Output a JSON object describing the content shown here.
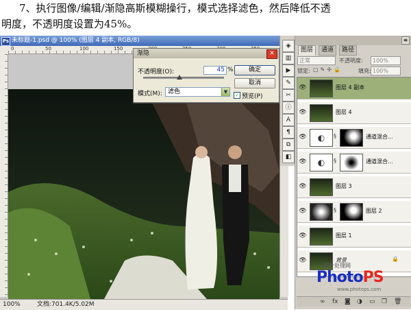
{
  "instruction": {
    "line1": "7、执行图像/编辑/渐隐高斯模糊操行，模式选择滤色，然后降低不透",
    "line2": "明度，不透明度设置为45%。"
  },
  "document": {
    "title": "未标题-1.psd @ 100% (图层 4 副本, RGB/8)",
    "ruler_numbers": [
      "0",
      "50",
      "100",
      "150",
      "200",
      "250",
      "300",
      "350"
    ],
    "status_zoom": "100%",
    "status_doc": "文档:701.4K/5.02M"
  },
  "fade_dialog": {
    "title": "渐隐",
    "opacity_label": "不透明度(O):",
    "opacity_value": "45",
    "percent": "%",
    "mode_label": "模式(M):",
    "mode_value": "滤色",
    "ok_label": "确定",
    "cancel_label": "取消",
    "preview_label": "预览(P)",
    "preview_checked": true,
    "opacity_fraction": 0.45
  },
  "tools": [
    {
      "icon": "navigator-icon",
      "glyph": "◈"
    },
    {
      "icon": "histogram-icon",
      "glyph": "▥"
    },
    {
      "icon": "play-icon",
      "glyph": "▶"
    },
    {
      "icon": "brush-icon",
      "glyph": "✎"
    },
    {
      "icon": "tools-icon",
      "glyph": "✂"
    },
    {
      "icon": "info-icon",
      "glyph": "ⓘ"
    },
    {
      "icon": "character-icon",
      "glyph": "A"
    },
    {
      "icon": "paragraph-icon",
      "glyph": "¶"
    },
    {
      "icon": "clone-icon",
      "glyph": "⧉"
    },
    {
      "icon": "layers-icon",
      "glyph": "◧"
    }
  ],
  "layers_panel": {
    "tabs": [
      "图层",
      "通道",
      "路径"
    ],
    "blend_mode": "正常",
    "opacity_label": "不透明度:",
    "opacity_value": "100%",
    "lock_label": "锁定:",
    "fill_label": "填充:",
    "fill_value": "100%",
    "layers": [
      {
        "name": "图层 4 副本",
        "selected": true,
        "mask": false,
        "thumb": "photo"
      },
      {
        "name": "图层 4",
        "selected": false,
        "mask": false,
        "thumb": "photo"
      },
      {
        "name": "通道混合...",
        "selected": false,
        "mask": true,
        "thumb": "adjust",
        "mask_style": "dark"
      },
      {
        "name": "通道混合...",
        "selected": false,
        "mask": true,
        "thumb": "adjust",
        "mask_style": "light"
      },
      {
        "name": "图层 3",
        "selected": false,
        "mask": false,
        "thumb": "photo"
      },
      {
        "name": "图层 2",
        "selected": false,
        "mask": true,
        "thumb": "gradient",
        "mask_style": "dark"
      },
      {
        "name": "图层 1",
        "selected": false,
        "mask": false,
        "thumb": "photo"
      },
      {
        "name": "背景",
        "selected": false,
        "mask": false,
        "thumb": "photo",
        "locked": true
      }
    ],
    "footer_icons": [
      "link-icon",
      "fx-icon",
      "mask-icon",
      "adjustment-icon",
      "folder-icon",
      "new-layer-icon",
      "trash-icon"
    ]
  },
  "watermark": {
    "subtitle": "照片处理网",
    "logo_letters": [
      "P",
      "h",
      "o",
      "t",
      "o",
      "P",
      "S"
    ],
    "logo_colors": [
      "#1a2ec0",
      "#1a2ec0",
      "#1a2ec0",
      "#1a2ec0",
      "#1a2ec0",
      "#e8261e",
      "#e8261e"
    ],
    "url": "www.photops.com"
  },
  "colors": {
    "selected_layer": "#9eb07a",
    "title_bar": "#3f69b8"
  }
}
